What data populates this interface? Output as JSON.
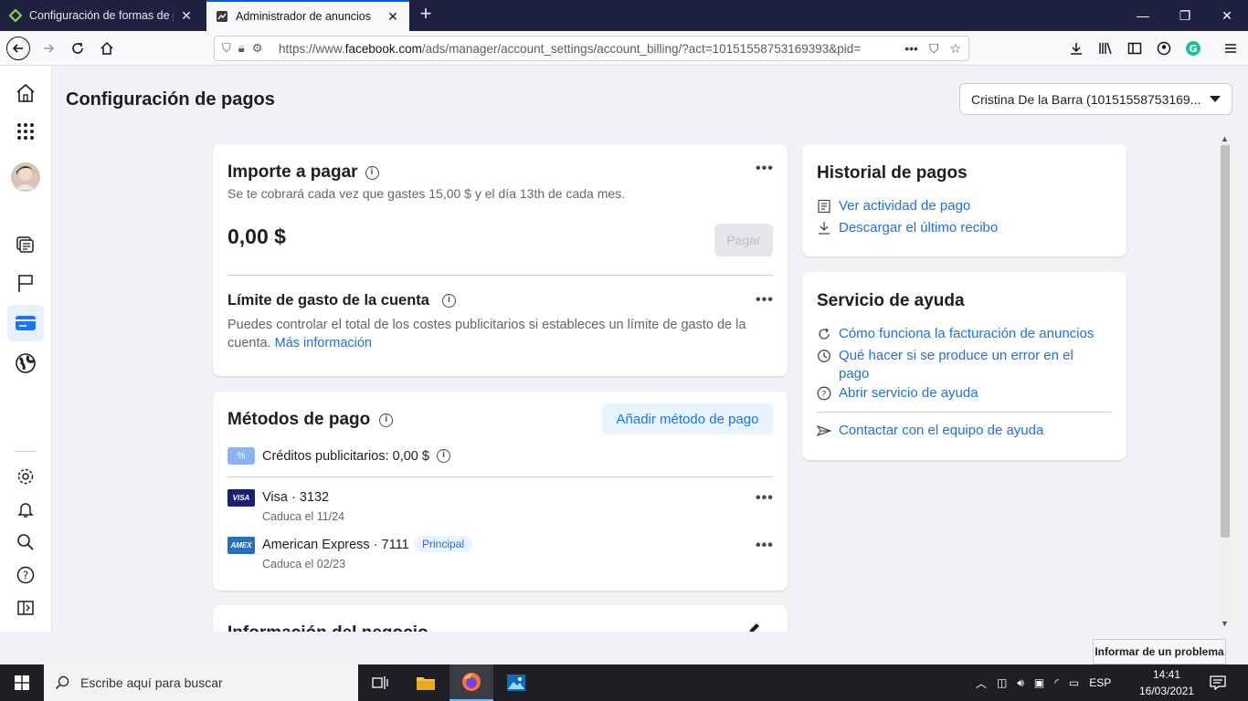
{
  "browser": {
    "tabs": [
      {
        "label": "Configuración de formas de pa",
        "active": false
      },
      {
        "label": "Administrador de anuncios",
        "active": true
      }
    ],
    "url_prefix": "https://www.",
    "url_domain": "facebook.com",
    "url_rest": "/ads/manager/account_settings/account_billing/?act=10151558753169393&pid=",
    "url_more": "•••"
  },
  "page": {
    "title": "Configuración de pagos",
    "account_selector": "Cristina De la Barra (10151558753169..."
  },
  "amount_card": {
    "title": "Importe a pagar",
    "subtitle": "Se te cobrará cada vez que gastes 15,00 $ y el día 13th de cada mes.",
    "amount": "0,00 $",
    "pay_button": "Pagar",
    "limit_title": "Límite de gasto de la cuenta",
    "limit_text": "Puedes controlar el total de los costes publicitarios si estableces un límite de gasto de la cuenta.",
    "limit_link": "Más información"
  },
  "payment_methods": {
    "title": "Métodos de pago",
    "add_button": "Añadir método de pago",
    "credits": "Créditos publicitarios: 0,00 $",
    "cards": [
      {
        "brand": "VISA",
        "name": "Visa · 3132",
        "expiry": "Caduca el 11/24",
        "badge": ""
      },
      {
        "brand": "AMEX",
        "name": "American Express · 7111",
        "expiry": "Caduca el 02/23",
        "badge": "Principal"
      }
    ]
  },
  "business_info": {
    "title": "Información del negocio"
  },
  "payment_history": {
    "title": "Historial de pagos",
    "links": [
      "Ver actividad de pago",
      "Descargar el último recibo"
    ]
  },
  "help_service": {
    "title": "Servicio de ayuda",
    "links": [
      "Cómo funciona la facturación de anuncios",
      "Qué hacer si se produce un error en el pago",
      "Abrir servicio de ayuda"
    ],
    "contact": "Contactar con el equipo de ayuda"
  },
  "report_button": "Informar de un problema",
  "taskbar": {
    "search_placeholder": "Escribe aquí para buscar",
    "language": "ESP",
    "time": "14:41",
    "date": "16/03/2021"
  },
  "colors": {
    "accent": "#1877f2",
    "link": "#216fdb",
    "tabstrip": "#1f2140"
  }
}
